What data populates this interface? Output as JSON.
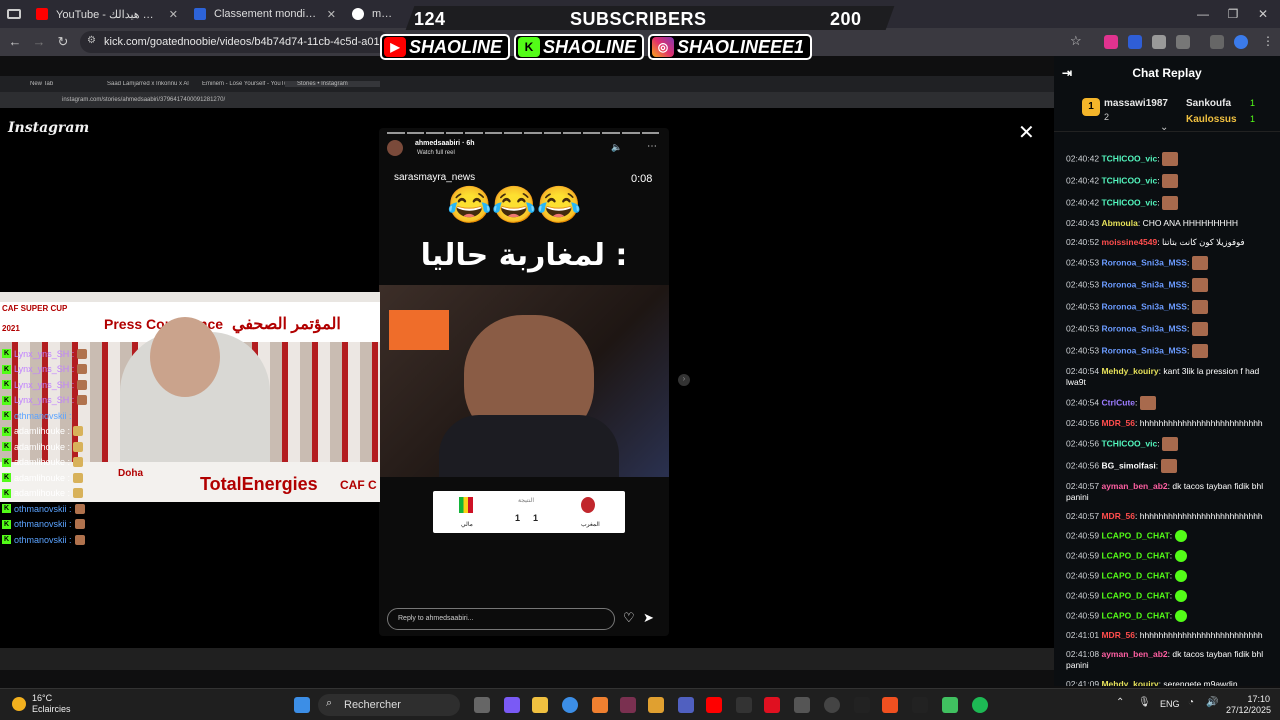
{
  "browser": {
    "tabs": [
      {
        "title": "YouTube - منتخب زمان هيدالك",
        "color": "#ff0000"
      },
      {
        "title": "Classement mondial FIFA/Coca",
        "color": "#2d63d8"
      },
      {
        "title": "mali - R",
        "color": "#ffffff"
      }
    ],
    "url": "kick.com/goatednoobie/videos/b4b74d74-11cb-4c5d-a018-83551c"
  },
  "overlay": {
    "count_left": "124",
    "subscribers": "SUBSCRIBERS",
    "count_right": "200",
    "youtube": "SHAOLINE",
    "kick": "SHAOLINE",
    "instagram": "SHAOLINEEE1"
  },
  "stream": {
    "inner_tabs": [
      "New Tab",
      "Saad Lamjarred x Inkonnu x Al",
      "Eminem - Lose Yourself - YouTu",
      "Stories • Instagram"
    ],
    "inner_url": "instagram.com/stories/ahmedsaabiri/3796417400091281270/",
    "instagram_logo": "Instagram",
    "story": {
      "username": "ahmedsaabiri",
      "age": "6h",
      "watch": "Watch full reel",
      "source": "sarasmayra_news",
      "time": "0:08",
      "emoji": "😂😂😂",
      "caption": "لمغاربة حاليا :",
      "score_home": "1",
      "score_away": "1",
      "team_left": "مالي",
      "team_right": "المغرب",
      "score_label": "النتيجة",
      "reply_placeholder": "Reply to ahmedsaabiri..."
    },
    "webcam": {
      "banner_ar": "المؤتمر الصحفي",
      "banner_en": "Press Conference",
      "side_tag": "CAF SUPER CUP",
      "year": "2021",
      "footer": "TotalEnergies",
      "footer2": "CAF C",
      "doha": "Doha"
    },
    "overlay_chat": [
      "Lynx_yns_SH :",
      "Lynx_yns_SH :",
      "Lynx_yns_SH :",
      "Lynx_yns_SH :",
      "othmanovskii :",
      "adamlihouke :",
      "adamlihouke :",
      "adamlihouke :",
      "adamlihouke :",
      "adamlihouke :",
      "othmanovskii :",
      "othmanovskii :",
      "othmanovskii :"
    ]
  },
  "chat": {
    "title": "Chat Replay",
    "leaders": [
      {
        "rank": "1",
        "name": "massawi1987",
        "count": "2"
      },
      {
        "rank": "",
        "name": "Sankoufa",
        "count": "1"
      },
      {
        "rank": "",
        "name": "Kaulossus",
        "count": "1"
      }
    ],
    "messages": [
      {
        "time": "02:40:42",
        "user": "TCHICOO_vic",
        "color": "#53f5bd",
        "text": "",
        "emote": "img"
      },
      {
        "time": "02:40:42",
        "user": "TCHICOO_vic",
        "color": "#53f5bd",
        "text": "",
        "emote": "img"
      },
      {
        "time": "02:40:42",
        "user": "TCHICOO_vic",
        "color": "#53f5bd",
        "text": "",
        "emote": "img"
      },
      {
        "time": "02:40:43",
        "user": "Abmoula",
        "color": "#e5e05a",
        "text": "CHO ANA HHHHHHHHH",
        "emote": ""
      },
      {
        "time": "02:40:52",
        "user": "moissine4549",
        "color": "#ff4d4d",
        "text": "فوفوزيلا كون كانت بتاتنا",
        "emote": ""
      },
      {
        "time": "02:40:53",
        "user": "Roronoa_Sni3a_MSS",
        "color": "#6b9bff",
        "text": "",
        "emote": "img"
      },
      {
        "time": "02:40:53",
        "user": "Roronoa_Sni3a_MSS",
        "color": "#6b9bff",
        "text": "",
        "emote": "img"
      },
      {
        "time": "02:40:53",
        "user": "Roronoa_Sni3a_MSS",
        "color": "#6b9bff",
        "text": "",
        "emote": "img"
      },
      {
        "time": "02:40:53",
        "user": "Roronoa_Sni3a_MSS",
        "color": "#6b9bff",
        "text": "",
        "emote": "img"
      },
      {
        "time": "02:40:53",
        "user": "Roronoa_Sni3a_MSS",
        "color": "#6b9bff",
        "text": "",
        "emote": "img"
      },
      {
        "time": "02:40:54",
        "user": "Mehdy_kouiry",
        "color": "#e5e05a",
        "text": "kant 3lik la pression f had lwa9t",
        "emote": ""
      },
      {
        "time": "02:40:54",
        "user": "CtrlCute",
        "color": "#9c7cff",
        "text": "",
        "emote": "img"
      },
      {
        "time": "02:40:56",
        "user": "MDR_56",
        "color": "#ff4d4d",
        "text": "hhhhhhhhhhhhhhhhhhhhhhhhhh",
        "emote": ""
      },
      {
        "time": "02:40:56",
        "user": "TCHICOO_vic",
        "color": "#53f5bd",
        "text": "",
        "emote": "img"
      },
      {
        "time": "02:40:56",
        "user": "BG_simolfasi",
        "color": "#ffffff",
        "text": "",
        "emote": "img"
      },
      {
        "time": "02:40:57",
        "user": "ayman_ben_ab2",
        "color": "#ff5fa2",
        "text": "dk tacos tayban fidik bhl panini",
        "emote": ""
      },
      {
        "time": "02:40:57",
        "user": "MDR_56",
        "color": "#ff4d4d",
        "text": "hhhhhhhhhhhhhhhhhhhhhhhhhh",
        "emote": ""
      },
      {
        "time": "02:40:59",
        "user": "LCAPO_D_CHAT",
        "color": "#53fc18",
        "text": "",
        "emote": "green"
      },
      {
        "time": "02:40:59",
        "user": "LCAPO_D_CHAT",
        "color": "#53fc18",
        "text": "",
        "emote": "green"
      },
      {
        "time": "02:40:59",
        "user": "LCAPO_D_CHAT",
        "color": "#53fc18",
        "text": "",
        "emote": "green"
      },
      {
        "time": "02:40:59",
        "user": "LCAPO_D_CHAT",
        "color": "#53fc18",
        "text": "",
        "emote": "green"
      },
      {
        "time": "02:40:59",
        "user": "LCAPO_D_CHAT",
        "color": "#53fc18",
        "text": "",
        "emote": "green"
      },
      {
        "time": "02:41:01",
        "user": "MDR_56",
        "color": "#ff4d4d",
        "text": "hhhhhhhhhhhhhhhhhhhhhhhhhh",
        "emote": ""
      },
      {
        "time": "02:41:08",
        "user": "ayman_ben_ab2",
        "color": "#ff5fa2",
        "text": "dk tacos tayban fidik bhl panini",
        "emote": ""
      },
      {
        "time": "02:41:09",
        "user": "Mehdy_kouiry",
        "color": "#e5e05a",
        "text": "serengete m9awdin",
        "emote": ""
      }
    ]
  },
  "taskbar": {
    "temp": "16°C",
    "weather": "Eclaircies",
    "search": "Rechercher",
    "lang": "ENG",
    "time": "17:10",
    "date": "27/12/2025"
  }
}
